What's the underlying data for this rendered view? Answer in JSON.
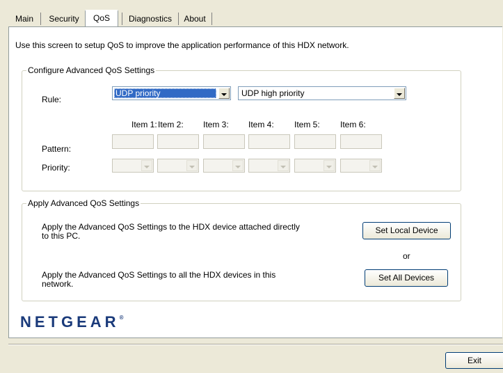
{
  "tabs": [
    {
      "label": "Main"
    },
    {
      "label": "Security"
    },
    {
      "label": "QoS"
    },
    {
      "label": "Diagnostics"
    },
    {
      "label": "About"
    }
  ],
  "active_tab": "QoS",
  "intro_text": "Use this screen to setup QoS to improve the application performance of this HDX network.",
  "configure": {
    "title": "Configure Advanced QoS Settings",
    "rule_label": "Rule:",
    "rule_type": "UDP priority",
    "rule_priority": "UDP high priority",
    "items": [
      "Item 1:",
      "Item 2:",
      "Item 3:",
      "Item 4:",
      "Item 5:",
      "Item 6:"
    ],
    "pattern_label": "Pattern:",
    "priority_label": "Priority:"
  },
  "apply": {
    "title": "Apply Advanced QoS Settings",
    "local_text": "Apply the Advanced QoS Settings to the HDX device attached directly to this PC.",
    "local_button": "Set Local Device",
    "or_text": "or",
    "all_text": "Apply the Advanced QoS Settings to all the HDX devices in this network.",
    "all_button": "Set All Devices"
  },
  "brand": {
    "logo_text": "NETGEAR",
    "logo_mark": "®",
    "logo_color": "#1a3a7a"
  },
  "footer": {
    "exit_button": "Exit"
  },
  "colors": {
    "selection": "#316ac5",
    "window_bg": "#ece9d8"
  }
}
